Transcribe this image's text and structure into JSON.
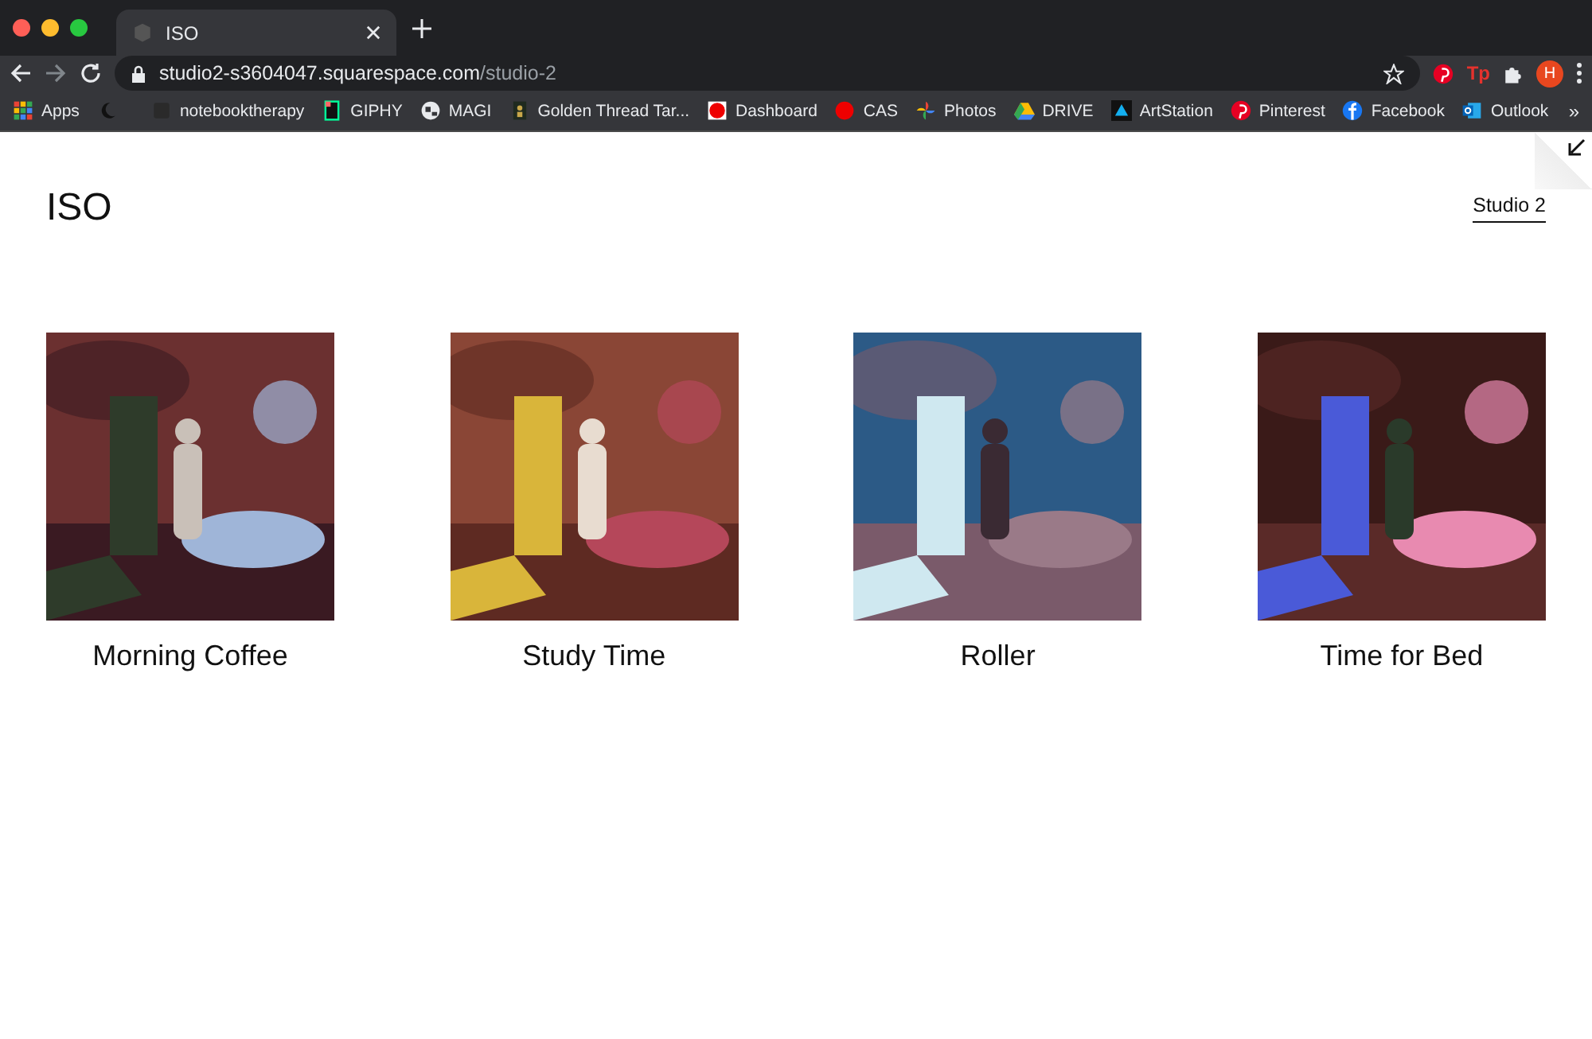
{
  "browser": {
    "tab": {
      "title": "ISO",
      "selected": true
    },
    "url": {
      "host": "studio2-s3604047.squarespace.com",
      "path": "/studio-2"
    },
    "extensions": [
      {
        "kind": "pinterest"
      },
      {
        "kind": "tp",
        "label": "Tp"
      },
      {
        "kind": "puzzle"
      },
      {
        "kind": "avatar",
        "label": "H"
      }
    ],
    "bookmarks": [
      {
        "kind": "apps",
        "label": "Apps"
      },
      {
        "kind": "moon"
      },
      {
        "kind": "blank",
        "label": "notebooktherapy"
      },
      {
        "kind": "giphy",
        "label": "GIPHY"
      },
      {
        "kind": "globe",
        "label": "MAGI"
      },
      {
        "kind": "tarot",
        "label": "Golden Thread Tar..."
      },
      {
        "kind": "square",
        "label": "Dashboard"
      },
      {
        "kind": "dot",
        "label": "CAS"
      },
      {
        "kind": "pinwheel",
        "label": "Photos"
      },
      {
        "kind": "drive",
        "label": "DRIVE"
      },
      {
        "kind": "artstation",
        "label": "ArtStation"
      },
      {
        "kind": "pinterest",
        "label": "Pinterest"
      },
      {
        "kind": "facebook",
        "label": "Facebook"
      },
      {
        "kind": "outlook",
        "label": "Outlook"
      }
    ],
    "more": "»"
  },
  "site": {
    "title": "ISO",
    "nav": [
      {
        "label": "Studio 2",
        "selected": true
      }
    ]
  },
  "gallery": [
    {
      "kind": "picture",
      "caption": "Morning Coffee"
    },
    {
      "kind": "picture",
      "caption": "Study Time"
    },
    {
      "kind": "picture",
      "caption": "Roller"
    },
    {
      "kind": "picture",
      "caption": "Time for Bed"
    }
  ]
}
